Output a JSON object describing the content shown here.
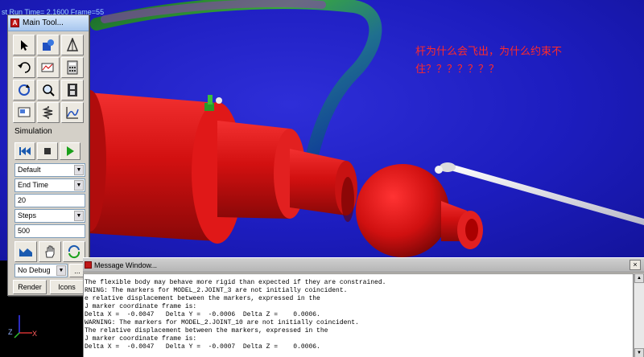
{
  "viewport": {
    "status_text": "st  Run   Time=   2.1600  Frame=55",
    "annotation_text": "杆为什么会飞出，为什么约束不住？？？？？？？",
    "colors": {
      "background": "#1d1dbf",
      "body_red": "#d01010",
      "rod_white": "#e8e8f0",
      "annotation": "#ff2a2a"
    }
  },
  "triad": {
    "z_label": "Z",
    "x_label": "X"
  },
  "toolbox": {
    "title": "Main Tool...",
    "app_icon": "A",
    "tools": [
      [
        "select-arrow-icon",
        "rigid-body-icon",
        "geometry-cone-icon"
      ],
      [
        "undo-arrow-icon",
        "plot-icon",
        "calculator-icon"
      ],
      [
        "rotate-view-icon",
        "zoom-icon",
        "animation-film-icon"
      ],
      [
        "screen-view-icon",
        "spring-icon",
        "graph-plot-icon"
      ]
    ],
    "simulation_label": "Simulation",
    "sim_controls": [
      "rewind-icon",
      "stop-icon",
      "play-icon"
    ],
    "mode_select": "Default",
    "time_select": "End Time",
    "end_time_value": "20",
    "steps_select": "Steps",
    "steps_value": "500",
    "bottom_tools": [
      "model-icon",
      "hand-pan-icon",
      "refresh-icon"
    ],
    "debug_select": "No Debug",
    "more_button": "...",
    "render_button": "Render",
    "icons_button": "Icons"
  },
  "message_window": {
    "title": "Message Window...",
    "close": "×",
    "lines": [
      "The flexible body may behave more rigid than expected if they are constrained.",
      "RNING: The markers for MODEL_2.JOINT_3 are not initially coincident.",
      "e relative displacement between the markers, expressed in the",
      "J marker coordinate frame is:",
      "Delta X =  -0.0047   Delta Y =  -0.0006  Delta Z =    0.0006.",
      "WARNING: The markers for MODEL_2.JOINT_10 are not initially coincident.",
      "The relative displacement between the markers, expressed in the",
      "J marker coordinate frame is:",
      "Delta X =  -0.0047   Delta Y =  -0.0007  Delta Z =    0.0006."
    ]
  }
}
